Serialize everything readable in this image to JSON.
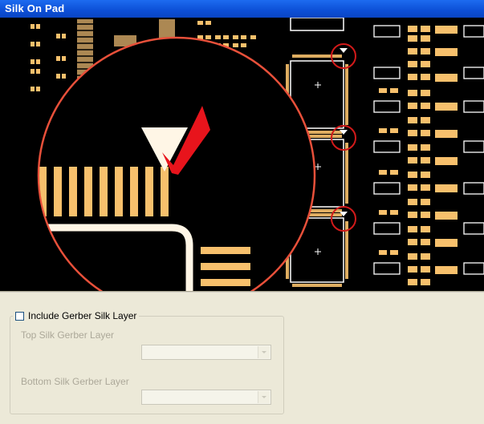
{
  "window": {
    "title": "Silk On Pad"
  },
  "preview": {
    "description_icon": "pcb-magnifier-image",
    "checkmark_color": "#e8141c",
    "pad_color": "#f7c06c",
    "circle_color": "#e8503a"
  },
  "options": {
    "include_label": "Include Gerber Silk Layer",
    "include_checked": false,
    "top_label": "Top Silk Gerber Layer",
    "top_value": "",
    "bottom_label": "Bottom Silk Gerber Layer",
    "bottom_value": ""
  }
}
